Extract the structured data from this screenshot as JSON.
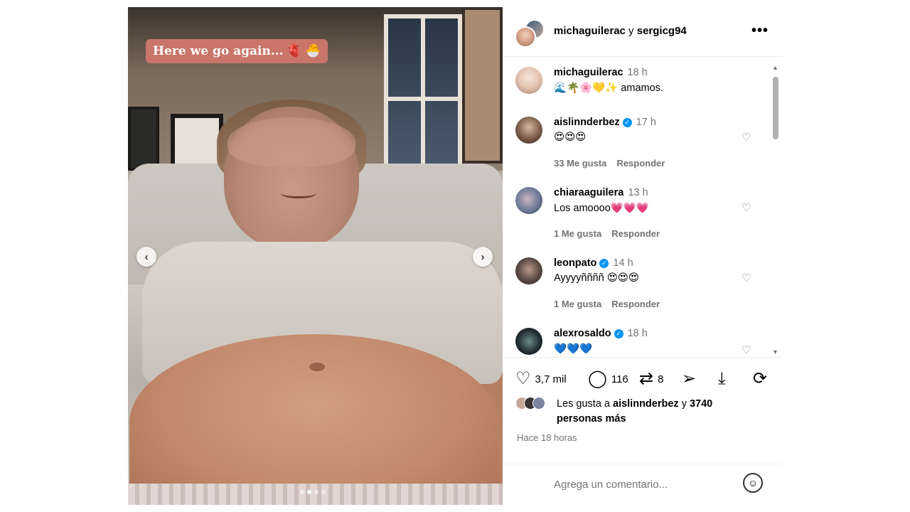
{
  "media": {
    "sticker_text": "Here we go again...",
    "sticker_icons": [
      "anatomical-heart-icon",
      "hatching-chick-icon"
    ],
    "prev_arrow": "‹",
    "next_arrow": "›",
    "carousel_dots": 4,
    "carousel_active": 1
  },
  "header": {
    "user1": "michaguilerac",
    "joiner": " y ",
    "user2": "sergicg94",
    "more": "•••"
  },
  "comments": [
    {
      "user": "michaguilerac",
      "time": "18 h",
      "verified": false,
      "text": "🌊🌴🌸💛✨ amamos.",
      "likes": "",
      "reply": "",
      "avatar_color": "#e9d7cc"
    },
    {
      "user": "aislinnderbez",
      "time": "17 h",
      "verified": true,
      "text": "😍😍😍",
      "likes": "33 Me gusta",
      "reply": "Responder",
      "avatar_color": "#4a3a30"
    },
    {
      "user": "chiaraaguilera",
      "time": "13 h",
      "verified": false,
      "text": "Los amoooo💗💗💗",
      "likes": "1 Me gusta",
      "reply": "Responder",
      "avatar_color": "#6d7a96"
    },
    {
      "user": "leonpato",
      "time": "14 h",
      "verified": true,
      "text": "Ayyyyññññ 😍😍😍",
      "likes": "1 Me gusta",
      "reply": "Responder",
      "avatar_color": "#5a4a44"
    },
    {
      "user": "alexrosaldo",
      "time": "18 h",
      "verified": true,
      "text": "💙💙💙",
      "likes": "",
      "reply": "",
      "avatar_color": "#1f2a2e"
    }
  ],
  "actions": {
    "like_count": "3,7 mil",
    "comment_count": "116",
    "repost_count": "8"
  },
  "likes": {
    "prefix": "Les gusta a ",
    "user": "aislinnderbez",
    "middle": " y ",
    "count": "3740",
    "suffix": "personas más"
  },
  "time_ago": "Hace 18 horas",
  "add_comment": {
    "placeholder": "Agrega un comentario..."
  }
}
